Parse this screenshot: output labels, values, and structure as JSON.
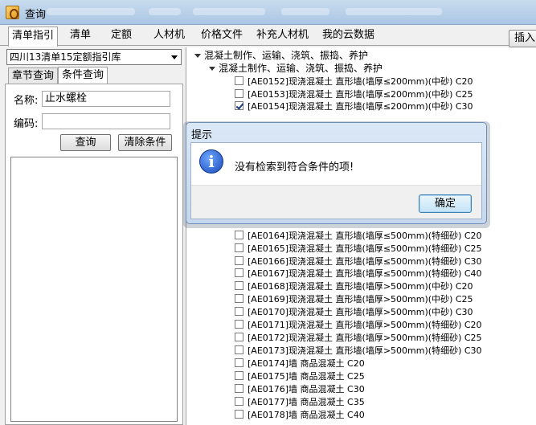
{
  "window": {
    "title": "查询"
  },
  "tabs": [
    {
      "label": "清单指引",
      "active": true
    },
    {
      "label": "清单",
      "active": false
    },
    {
      "label": "定额",
      "active": false
    },
    {
      "label": "人材机",
      "active": false
    },
    {
      "label": "价格文件",
      "active": false
    },
    {
      "label": "补充人材机",
      "active": false
    },
    {
      "label": "我的云数据",
      "active": false
    }
  ],
  "toolbar": {
    "insert_label": "插入"
  },
  "left": {
    "library": "四川13清单15定额指引库",
    "subtabs": [
      {
        "label": "章节查询",
        "active": false
      },
      {
        "label": "条件查询",
        "active": true
      }
    ],
    "name_label": "名称:",
    "name_value": "止水螺栓",
    "code_label": "编码:",
    "code_value": "",
    "search_label": "查询",
    "clear_label": "清除条件"
  },
  "tree": {
    "root": "混凝土制作、运输、浇筑、振捣、养护",
    "child": "混凝土制作、运输、浇筑、振捣、养护",
    "items_top": [
      {
        "text": "[AE0152]现浇混凝土 直形墙(墙厚≤200mm)(中砂) C20",
        "checked": false
      },
      {
        "text": "[AE0153]现浇混凝土 直形墙(墙厚≤200mm)(中砂) C25",
        "checked": false
      },
      {
        "text": "[AE0154]现浇混凝土 直形墙(墙厚≤200mm)(中砂) C30",
        "checked": true
      }
    ],
    "items_bottom": [
      {
        "text": "[AE0164]现浇混凝土 直形墙(墙厚≤500mm)(特细砂) C20",
        "checked": false
      },
      {
        "text": "[AE0165]现浇混凝土 直形墙(墙厚≤500mm)(特细砂) C25",
        "checked": false
      },
      {
        "text": "[AE0166]现浇混凝土 直形墙(墙厚≤500mm)(特细砂) C30",
        "checked": false
      },
      {
        "text": "[AE0167]现浇混凝土 直形墙(墙厚≤500mm)(特细砂) C40",
        "checked": false
      },
      {
        "text": "[AE0168]现浇混凝土 直形墙(墙厚>500mm)(中砂) C20",
        "checked": false
      },
      {
        "text": "[AE0169]现浇混凝土 直形墙(墙厚>500mm)(中砂) C25",
        "checked": false
      },
      {
        "text": "[AE0170]现浇混凝土 直形墙(墙厚>500mm)(中砂) C30",
        "checked": false
      },
      {
        "text": "[AE0171]现浇混凝土 直形墙(墙厚>500mm)(特细砂) C20",
        "checked": false
      },
      {
        "text": "[AE0172]现浇混凝土 直形墙(墙厚>500mm)(特细砂) C25",
        "checked": false
      },
      {
        "text": "[AE0173]现浇混凝土 直形墙(墙厚>500mm)(特细砂) C30",
        "checked": false
      },
      {
        "text": "[AE0174]墙 商品混凝土 C20",
        "checked": false
      },
      {
        "text": "[AE0175]墙 商品混凝土 C25",
        "checked": false
      },
      {
        "text": "[AE0176]墙 商品混凝土 C30",
        "checked": false
      },
      {
        "text": "[AE0177]墙 商品混凝土 C35",
        "checked": false
      },
      {
        "text": "[AE0178]墙 商品混凝土 C40",
        "checked": false
      }
    ]
  },
  "dialog": {
    "title": "提示",
    "message": "没有检索到符合条件的项!",
    "ok_label": "确定"
  }
}
